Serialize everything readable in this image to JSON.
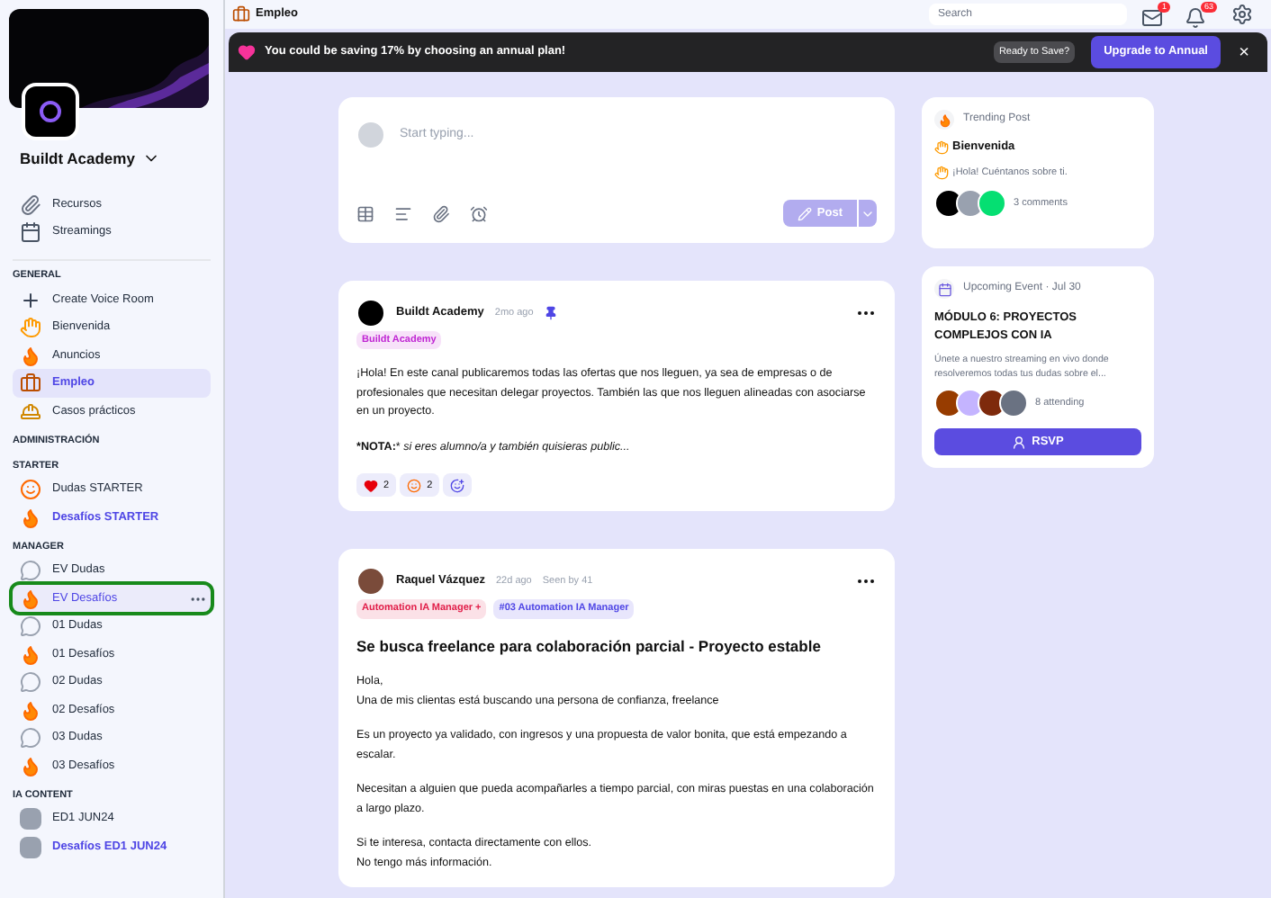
{
  "sidebar": {
    "community": "Buildt Academy",
    "links": [
      {
        "label": "Recursos",
        "kind": "clip"
      },
      {
        "label": "Streamings",
        "kind": "calendar"
      }
    ],
    "sections": [
      {
        "title": "GENERAL",
        "items": [
          {
            "label": "Create Voice Room",
            "kind": "plus",
            "selected": false,
            "bold": false,
            "highlighted": false
          },
          {
            "label": "Bienvenida",
            "kind": "wave",
            "selected": false,
            "bold": false,
            "highlighted": false
          },
          {
            "label": "Anuncios",
            "kind": "fire",
            "selected": false,
            "bold": false,
            "highlighted": false
          },
          {
            "label": "Empleo",
            "kind": "bag",
            "selected": true,
            "bold": true,
            "highlighted": false
          },
          {
            "label": "Casos prácticos",
            "kind": "worker",
            "selected": false,
            "bold": false,
            "highlighted": false
          }
        ]
      },
      {
        "title": "ADMINISTRACIÓN"
      },
      {
        "title": "STARTER",
        "items": [
          {
            "label": "Dudas STARTER",
            "kind": "face",
            "selected": false,
            "bold": false,
            "highlighted": false
          },
          {
            "label": "Desafíos STARTER",
            "kind": "fire",
            "selected": false,
            "bold": true,
            "highlighted": false
          }
        ]
      },
      {
        "title": "MANAGER",
        "items": [
          {
            "label": "EV Dudas",
            "kind": "chat",
            "selected": false,
            "bold": false,
            "highlighted": false
          },
          {
            "label": "EV Desafíos",
            "kind": "fire",
            "selected": false,
            "bold": false,
            "highlighted": true
          },
          {
            "label": "01 Dudas",
            "kind": "chat",
            "selected": false,
            "bold": false,
            "highlighted": false
          },
          {
            "label": "01 Desafíos",
            "kind": "fire",
            "selected": false,
            "bold": false,
            "highlighted": false
          },
          {
            "label": "02 Dudas",
            "kind": "chat",
            "selected": false,
            "bold": false,
            "highlighted": false
          },
          {
            "label": "02 Desafíos",
            "kind": "fire",
            "selected": false,
            "bold": false,
            "highlighted": false
          },
          {
            "label": "03 Dudas",
            "kind": "chat",
            "selected": false,
            "bold": false,
            "highlighted": false
          },
          {
            "label": "03 Desafíos",
            "kind": "fire",
            "selected": false,
            "bold": false,
            "highlighted": false
          }
        ]
      },
      {
        "title": "IA CONTENT",
        "items": [
          {
            "label": "ED1 JUN24",
            "kind": "one",
            "selected": false,
            "bold": false,
            "highlighted": false
          },
          {
            "label": "Desafíos ED1 JUN24",
            "kind": "one",
            "selected": false,
            "bold": true,
            "highlighted": false
          }
        ]
      }
    ]
  },
  "topbar": {
    "title": "Empleo",
    "search": {
      "placeholder": "Search"
    },
    "mail_count": "1",
    "bell_count": "63"
  },
  "banner": {
    "text": "You could be saving 17% by choosing an annual plan!",
    "hint": "Ready to Save?",
    "button": "Upgrade to Annual",
    "close": "×"
  },
  "composer": {
    "placeholder": "Start typing...",
    "button": "Post"
  },
  "posts": [
    {
      "author": "Buildt Academy",
      "time": "2mo ago",
      "pinned": true,
      "tags": [
        {
          "label": "Buildt Academy",
          "color": "#c026d3"
        }
      ],
      "paragraphs": [
        "¡Hola! En este canal publicaremos todas las ofertas que nos lleguen, ya sea de empresas o de profesionales que necesitan delegar proyectos. También las que nos lleguen alineadas con asociarse en un proyecto.",
        "***NOTA:*** *si eres alumno/a y también quisieras public...*"
      ],
      "reactions": [
        {
          "kind": "heart",
          "count": "2"
        },
        {
          "kind": "smile",
          "count": "2"
        },
        {
          "kind": "add"
        }
      ]
    },
    {
      "author": "Raquel Vázquez",
      "time": "22d ago",
      "seen": "Seen by 41",
      "pinned": false,
      "tags": [
        {
          "label": "Automation IA Manager +",
          "color": "#e11d48"
        },
        {
          "label": "#03 Automation IA Manager",
          "color": "#4f46e5"
        }
      ],
      "title": "Se busca freelance para colaboración parcial - Proyecto estable",
      "paragraphs": [
        "Hola,\nUna de mis clientas está buscando una persona de confianza, freelance",
        "Es un proyecto ya validado, con ingresos y una propuesta de valor bonita, que está empezando a escalar.",
        "Necesitan a alguien que pueda acompañarles a tiempo parcial, con miras puestas en una colaboración a largo plazo.",
        "Si te interesa, contacta directamente con ellos.\nNo tengo más información."
      ]
    }
  ],
  "trending": {
    "heading": "Trending Post",
    "title": "Bienvenida",
    "excerpt": "¡Hola! Cuéntanos sobre ti.",
    "comments": "3 comments"
  },
  "event": {
    "heading": "Upcoming Event · Jul 30",
    "title": "MÓDULO 6: PROYECTOS COMPLEJOS CON IA",
    "excerpt": "Únete a nuestro streaming en vivo donde resolveremos todas tus dudas sobre el...",
    "attending": "8 attending",
    "button": "RSVP"
  }
}
